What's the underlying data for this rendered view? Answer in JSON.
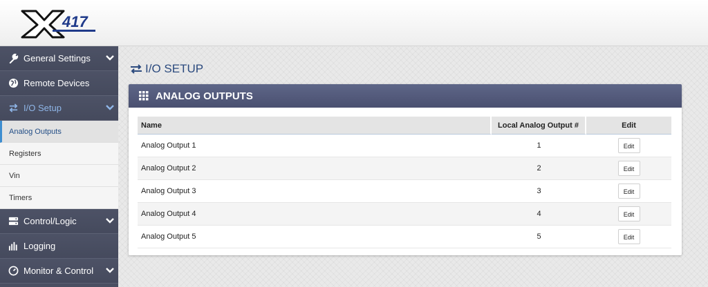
{
  "app": {
    "logo_text": "X417"
  },
  "colors": {
    "sidebar_bg": "#4a4f62",
    "active_nav": "#8fb6e8",
    "panel_header": "#4a5070",
    "title_text": "#2b4a7e"
  },
  "sidebar": {
    "items": [
      {
        "label": "General Settings",
        "icon": "wrench-icon",
        "expandable": true
      },
      {
        "label": "Remote Devices",
        "icon": "globe-icon",
        "expandable": false
      },
      {
        "label": "I/O Setup",
        "icon": "swap-arrows-icon",
        "expandable": true,
        "active": true
      }
    ],
    "sub_items": [
      {
        "label": "Analog Outputs",
        "active": true
      },
      {
        "label": "Registers"
      },
      {
        "label": "Vin"
      },
      {
        "label": "Timers"
      }
    ],
    "items_after": [
      {
        "label": "Control/Logic",
        "icon": "server-icon",
        "expandable": true
      },
      {
        "label": "Logging",
        "icon": "bars-icon",
        "expandable": false
      },
      {
        "label": "Monitor & Control",
        "icon": "gauge-icon",
        "expandable": true
      }
    ]
  },
  "page": {
    "title": "I/O SETUP"
  },
  "panel": {
    "title": "ANALOG OUTPUTS",
    "columns": [
      "Name",
      "Local Analog Output #",
      "Edit"
    ],
    "rows": [
      {
        "name": "Analog Output 1",
        "number": "1",
        "edit": "Edit"
      },
      {
        "name": "Analog Output 2",
        "number": "2",
        "edit": "Edit"
      },
      {
        "name": "Analog Output 3",
        "number": "3",
        "edit": "Edit"
      },
      {
        "name": "Analog Output 4",
        "number": "4",
        "edit": "Edit"
      },
      {
        "name": "Analog Output 5",
        "number": "5",
        "edit": "Edit"
      }
    ]
  }
}
